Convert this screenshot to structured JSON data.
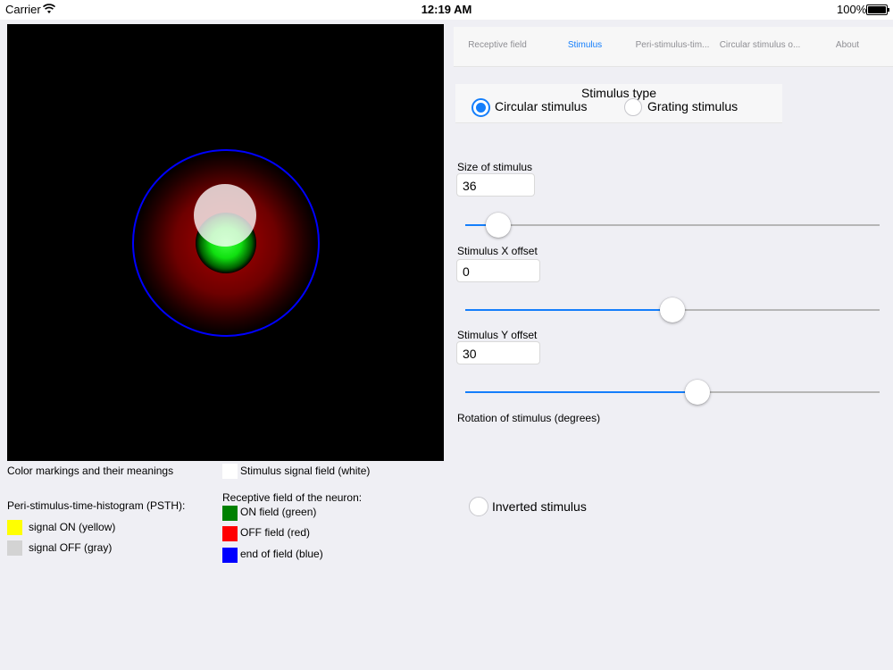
{
  "status_bar": {
    "carrier": "Carrier",
    "time": "12:19 AM",
    "battery": "100%"
  },
  "tabs": [
    {
      "label": "Receptive field",
      "active": false
    },
    {
      "label": "Stimulus",
      "active": true
    },
    {
      "label": "Peri-stimulus-tim...",
      "active": false
    },
    {
      "label": "Circular stimulus o...",
      "active": false
    },
    {
      "label": "About",
      "active": false
    }
  ],
  "stimulus_type": {
    "title": "Stimulus type",
    "options": [
      {
        "label": "Circular stimulus",
        "selected": true
      },
      {
        "label": "Grating stimulus",
        "selected": false
      }
    ]
  },
  "controls": {
    "size": {
      "label": "Size of stimulus",
      "value": "36",
      "slider_fraction": 0.08
    },
    "x_offset": {
      "label": "Stimulus X offset",
      "value": "0",
      "slider_fraction": 0.5
    },
    "y_offset": {
      "label": "Stimulus Y offset",
      "value": "30",
      "slider_fraction": 0.56
    },
    "rotation": {
      "label": "Rotation of stimulus (degrees)"
    }
  },
  "inverted": {
    "label": "Inverted stimulus",
    "checked": false
  },
  "legend": {
    "heading": "Color markings and their meanings",
    "stimulus_signal": "Stimulus signal field (white)",
    "psth_heading": "Peri-stimulus-time-histogram (PSTH):",
    "signal_on": "signal ON (yellow)",
    "signal_off": "signal OFF (gray)",
    "receptive_heading": "Receptive field of the neuron:",
    "on_field": "ON field (green)",
    "off_field": "OFF field (red)",
    "end_field": "end of field (blue)"
  },
  "colors": {
    "accent": "#147efb",
    "yellow": "#ffff00",
    "gray": "#d3d3d3",
    "green": "#008000",
    "red": "#ff0000",
    "blue": "#0000ff",
    "white": "#ffffff"
  }
}
